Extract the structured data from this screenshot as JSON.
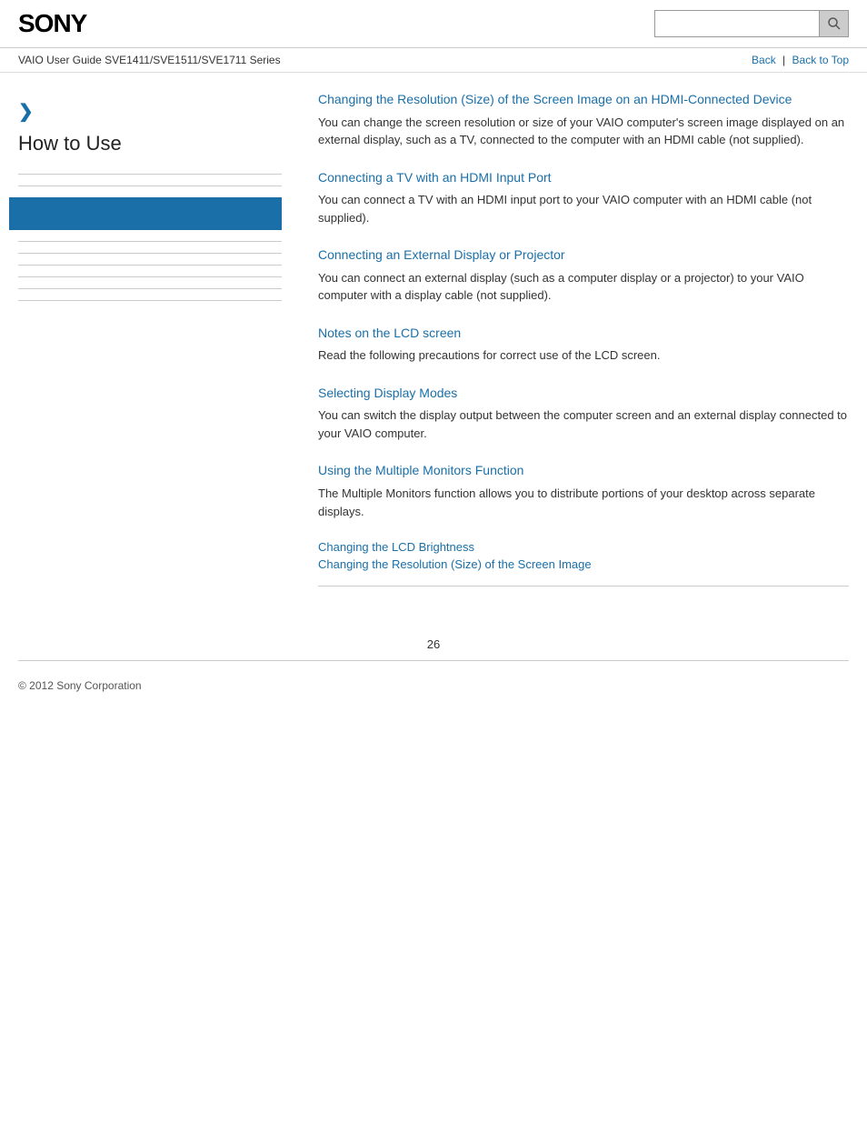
{
  "header": {
    "logo": "SONY",
    "search_placeholder": ""
  },
  "navbar": {
    "guide_text": "VAIO User Guide SVE1411/SVE1511/SVE1711 Series",
    "back_label": "Back",
    "back_to_top_label": "Back to Top"
  },
  "sidebar": {
    "arrow": "❯",
    "title": "How to Use",
    "items": [
      {
        "label": "",
        "active": false
      },
      {
        "label": "",
        "active": false
      },
      {
        "label": "",
        "active": true
      },
      {
        "label": "",
        "active": false
      },
      {
        "label": "",
        "active": false
      },
      {
        "label": "",
        "active": false
      },
      {
        "label": "",
        "active": false
      },
      {
        "label": "",
        "active": false
      },
      {
        "label": "",
        "active": false
      }
    ]
  },
  "content": {
    "sections": [
      {
        "id": "hdmi-resolution",
        "link_text": "Changing the Resolution (Size) of the Screen Image on an HDMI-Connected Device",
        "desc": "You can change the screen resolution or size of your VAIO computer's screen image displayed on an external display, such as a TV, connected to the computer with an HDMI cable (not supplied)."
      },
      {
        "id": "tv-hdmi",
        "link_text": "Connecting a TV with an HDMI Input Port",
        "desc": "You can connect a TV with an HDMI input port to your VAIO computer with an HDMI cable (not supplied)."
      },
      {
        "id": "external-display",
        "link_text": "Connecting an External Display or Projector",
        "desc": "You can connect an external display (such as a computer display or a projector) to your VAIO computer with a display cable (not supplied)."
      },
      {
        "id": "lcd-notes",
        "link_text": "Notes on the LCD screen",
        "desc": "Read the following precautions for correct use of the LCD screen."
      },
      {
        "id": "display-modes",
        "link_text": "Selecting Display Modes",
        "desc": "You can switch the display output between the computer screen and an external display connected to your VAIO computer."
      },
      {
        "id": "multiple-monitors",
        "link_text": "Using the Multiple Monitors Function",
        "desc": "The Multiple Monitors function allows you to distribute portions of your desktop across separate displays."
      }
    ],
    "bottom_links": [
      {
        "label": "Changing the LCD Brightness"
      },
      {
        "label": "Changing the Resolution (Size) of the Screen Image"
      }
    ]
  },
  "footer": {
    "copyright": "© 2012 Sony Corporation",
    "page_number": "26"
  }
}
